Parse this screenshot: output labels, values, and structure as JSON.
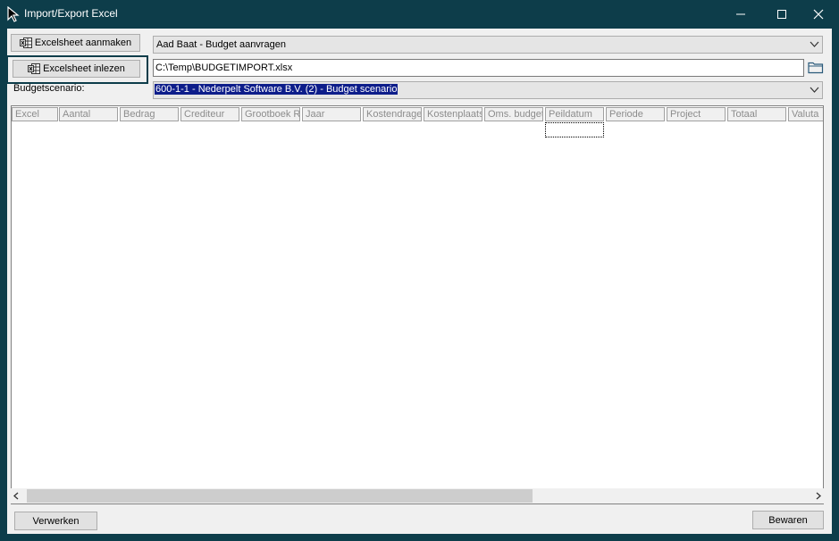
{
  "window": {
    "title": "Import/Export Excel",
    "app_icon": "cursor-arrow-icon",
    "controls": [
      "minimize-icon",
      "maximize-icon",
      "close-icon"
    ]
  },
  "toolbar": {
    "create_sheet_label": "Excelsheet aanmaken",
    "read_sheet_label": "Excelsheet inlezen",
    "button_icon": "excel-sheet-icon"
  },
  "form": {
    "owner_value": "Aad Baat - Budget aanvragen",
    "file_path": "C:\\Temp\\BUDGETIMPORT.xlsx",
    "scenario_label": "Budgetscenario:",
    "scenario_value": "600-1-1 - Nederpelt Software B.V. (2) - Budget scenario"
  },
  "grid": {
    "columns": [
      "Excel",
      "Aantal",
      "Bedrag",
      "Crediteur",
      "Grootboek Re",
      "Jaar",
      "Kostendrage",
      "Kostenplaats",
      "Oms. budget",
      "Peildatum",
      "Periode",
      "Project",
      "Totaal",
      "Valuta"
    ],
    "rows": []
  },
  "footer": {
    "process_label": "Verwerken",
    "save_label": "Bewaren"
  },
  "colors": {
    "title_bar": "#0d3d4a",
    "selection": "#0d1d8a",
    "client_background": "#f0f0f0"
  }
}
